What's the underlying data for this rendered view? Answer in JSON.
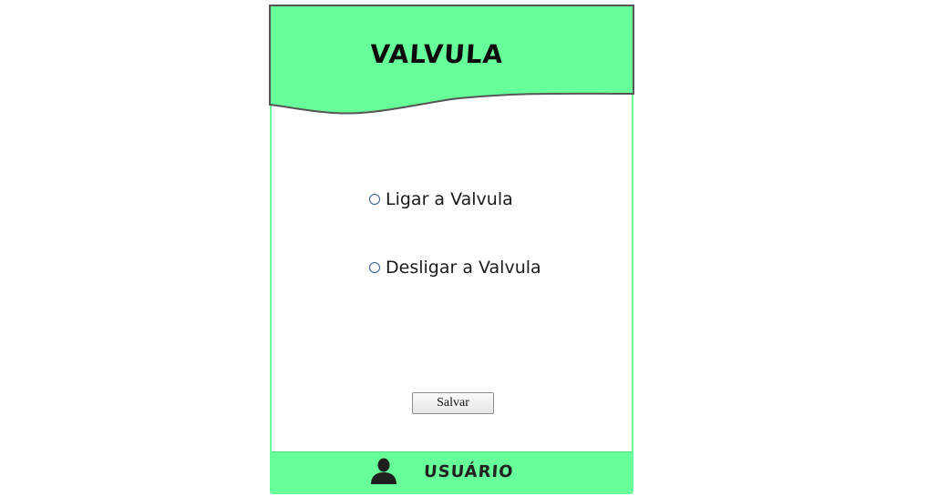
{
  "header": {
    "title": "VALVULA"
  },
  "form": {
    "options": [
      {
        "label": "Ligar a Valvula",
        "selected": false
      },
      {
        "label": "Desligar a Valvula",
        "selected": false
      }
    ],
    "save_label": "Salvar"
  },
  "footer": {
    "user_label": "USUÁRIO",
    "icon": "user-icon"
  },
  "colors": {
    "accent": "#66ff99",
    "radio_border": "#2e5a8c",
    "header_outline": "#555555"
  }
}
